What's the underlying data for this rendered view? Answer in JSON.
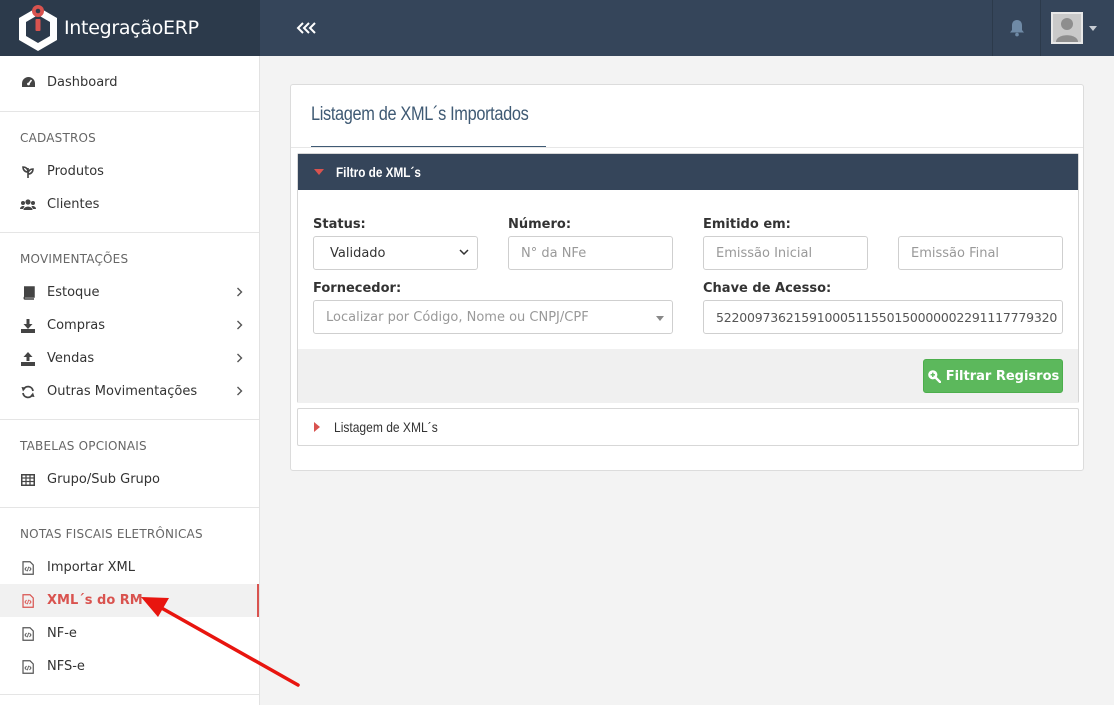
{
  "brand": {
    "name": "IntegraçãoERP"
  },
  "sidebar": {
    "dashboard": "Dashboard",
    "sections": [
      {
        "title": "CADASTROS",
        "items": [
          "Produtos",
          "Clientes"
        ]
      },
      {
        "title": "MOVIMENTAÇÕES",
        "items": [
          "Estoque",
          "Compras",
          "Vendas",
          "Outras Movimentações"
        ]
      },
      {
        "title": "TABELAS OPCIONAIS",
        "items": [
          "Grupo/Sub Grupo"
        ]
      },
      {
        "title": "NOTAS FISCAIS ELETRÔNICAS",
        "items": [
          "Importar XML",
          "XML´s do RM",
          "NF-e",
          "NFS-e"
        ]
      }
    ],
    "active_item": "XML´s do RM"
  },
  "main": {
    "title": "Listagem de XML´s Importados",
    "filter": {
      "header": "Filtro de XML´s",
      "status_label": "Status:",
      "status_value": "Validado",
      "numero_label": "Número:",
      "numero_placeholder": "N° da NFe",
      "emitido_label": "Emitido em:",
      "emissao_inicial_placeholder": "Emissão Inicial",
      "emissao_final_placeholder": "Emissão Final",
      "fornecedor_label": "Fornecedor:",
      "fornecedor_placeholder": "Localizar por Código, Nome ou CNPJ/CPF",
      "chave_label": "Chave de Acesso:",
      "chave_value": "52200973621591000511550150000002291117779320",
      "button_label": "Filtrar Regisros"
    },
    "list_header": "Listagem de XML´s"
  },
  "colors": {
    "topbar": "#35455a",
    "brand_bg": "#2c3a4b",
    "accent_red": "#d9534f",
    "success": "#5cb85c",
    "title_blue": "#3f5a74"
  }
}
